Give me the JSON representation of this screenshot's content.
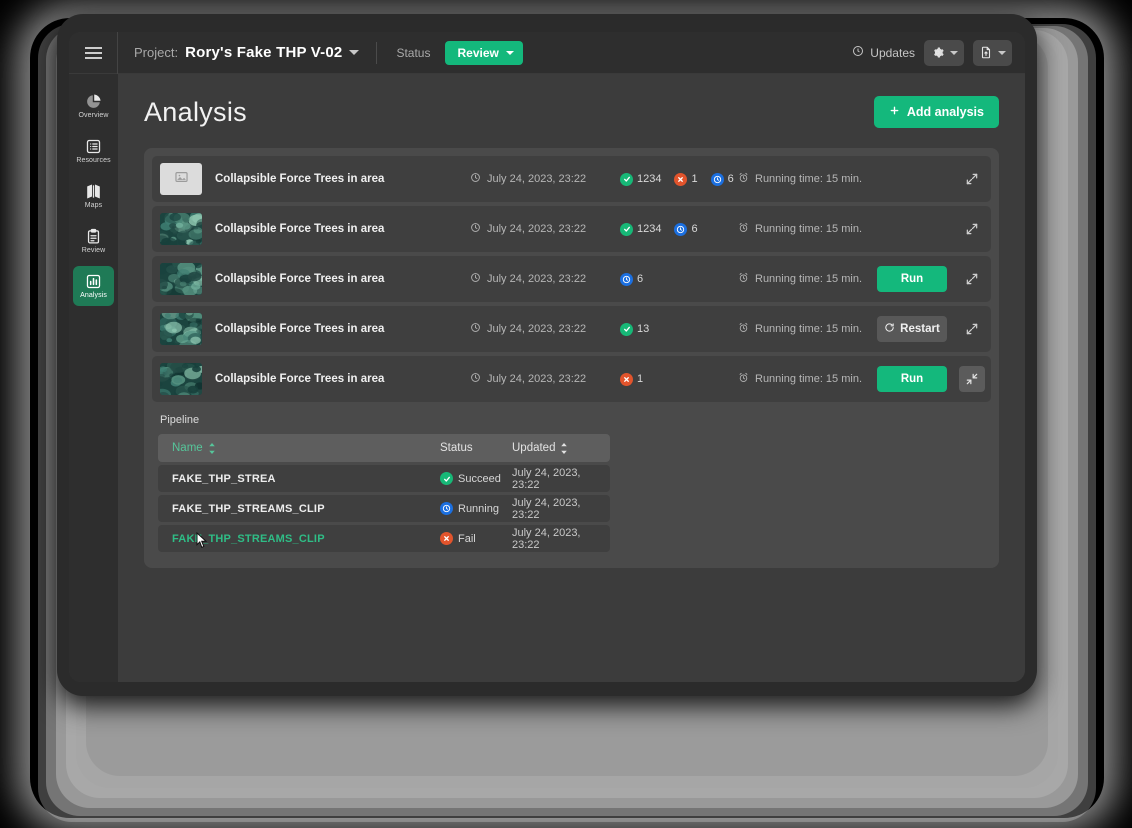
{
  "topbar": {
    "menu_icon": "hamburger-icon",
    "project_label": "Project:",
    "project_name": "Rory's Fake THP V-02",
    "status_label": "Status",
    "status_value": "Review",
    "updates_label": "Updates",
    "updates_icon": "clock-icon",
    "settings_icon": "gear-icon",
    "export_icon": "file-upload-icon"
  },
  "sidebar": {
    "items": [
      {
        "label": "Overview",
        "icon": "pie-chart-icon",
        "active": false
      },
      {
        "label": "Resources",
        "icon": "list-icon",
        "active": false
      },
      {
        "label": "Maps",
        "icon": "map-icon",
        "active": false
      },
      {
        "label": "Review",
        "icon": "clipboard-icon",
        "active": false
      },
      {
        "label": "Analysis",
        "icon": "bar-chart-icon",
        "active": true
      }
    ]
  },
  "main": {
    "page_title": "Analysis",
    "add_button_label": "Add analysis",
    "add_button_icon": "plus-icon"
  },
  "analyses": [
    {
      "thumb": "placeholder",
      "title": "Collapsible Force Trees in area",
      "date": "July 24, 2023, 23:22",
      "badges": [
        {
          "type": "ok",
          "value": "1234"
        },
        {
          "type": "err",
          "value": "1"
        },
        {
          "type": "run",
          "value": "6"
        }
      ],
      "runtime": "Running time: 15 min.",
      "action": null,
      "expand_state": "expand"
    },
    {
      "thumb": "satellite",
      "title": "Collapsible Force Trees in area",
      "date": "July 24, 2023, 23:22",
      "badges": [
        {
          "type": "ok",
          "value": "1234"
        },
        {
          "type": "run",
          "value": "6"
        }
      ],
      "runtime": "Running time: 15 min.",
      "action": null,
      "expand_state": "expand"
    },
    {
      "thumb": "satellite",
      "title": "Collapsible Force Trees in area",
      "date": "July 24, 2023, 23:22",
      "badges": [
        {
          "type": "run",
          "value": "6"
        }
      ],
      "runtime": "Running time: 15 min.",
      "action": {
        "kind": "run",
        "label": "Run"
      },
      "expand_state": "expand"
    },
    {
      "thumb": "satellite",
      "title": "Collapsible Force Trees in area",
      "date": "July 24, 2023, 23:22",
      "badges": [
        {
          "type": "ok",
          "value": "13"
        }
      ],
      "runtime": "Running time: 15 min.",
      "action": {
        "kind": "restart",
        "label": "Restart",
        "icon": "refresh-icon"
      },
      "expand_state": "expand"
    },
    {
      "thumb": "satellite",
      "title": "Collapsible Force Trees in area",
      "date": "July 24, 2023, 23:22",
      "badges": [
        {
          "type": "err",
          "value": "1"
        }
      ],
      "runtime": "Running time: 15 min.",
      "action": {
        "kind": "run",
        "label": "Run"
      },
      "expand_state": "collapse"
    }
  ],
  "pipeline": {
    "title": "Pipeline",
    "columns": [
      {
        "key": "name",
        "label": "Name",
        "sortable": true,
        "active_sort": true
      },
      {
        "key": "status",
        "label": "Status",
        "sortable": false,
        "active_sort": false
      },
      {
        "key": "updated",
        "label": "Updated",
        "sortable": true,
        "active_sort": false
      }
    ],
    "rows": [
      {
        "name": "FAKE_THP_STREA",
        "status": "Succeed",
        "status_type": "ok",
        "updated": "July 24, 2023, 23:22",
        "hovered": false
      },
      {
        "name": "FAKE_THP_STREAMS_CLIP",
        "status": "Running",
        "status_type": "run",
        "updated": "July 24, 2023, 23:22",
        "hovered": false
      },
      {
        "name": "FAKE_THP_STREAMS_CLIP",
        "status": "Fail",
        "status_type": "err",
        "updated": "July 24, 2023, 23:22",
        "hovered": true
      }
    ]
  },
  "colors": {
    "accent_green": "#14b87c",
    "status_ok": "#17b877",
    "status_error": "#e2542c",
    "status_running": "#1b6fe0",
    "sidebar_active": "#1f7a56",
    "panel_bg": "#4a4a4a",
    "row_bg": "#3f3f3f",
    "app_bg": "#3c3c3c",
    "topbar_bg": "#2e2e2e"
  }
}
